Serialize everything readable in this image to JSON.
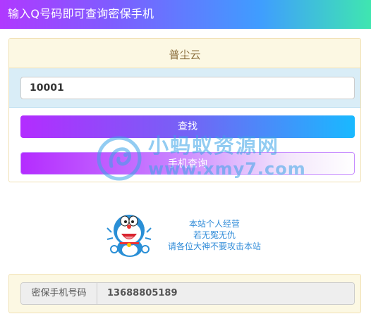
{
  "header": {
    "title": "输入Q号码即可查询密保手机"
  },
  "panel": {
    "title": "普尘云",
    "input": {
      "value": "10001",
      "placeholder": ""
    },
    "search_button": "查找",
    "phone_button": "手机查询"
  },
  "watermark": {
    "name": "小蚂蚁资源网",
    "url": "www.xmy7.com"
  },
  "notice": {
    "lines": [
      "本站个人经营",
      "若无冤无仇",
      "请各位大神不要攻击本站"
    ]
  },
  "result": {
    "label": "密保手机号码",
    "value": "13688805189"
  },
  "colors": {
    "accent_purple": "#b32cff",
    "accent_blue": "#19b9ff",
    "warning_bg": "#fcf8e3",
    "info_bg": "#d9edf7"
  }
}
